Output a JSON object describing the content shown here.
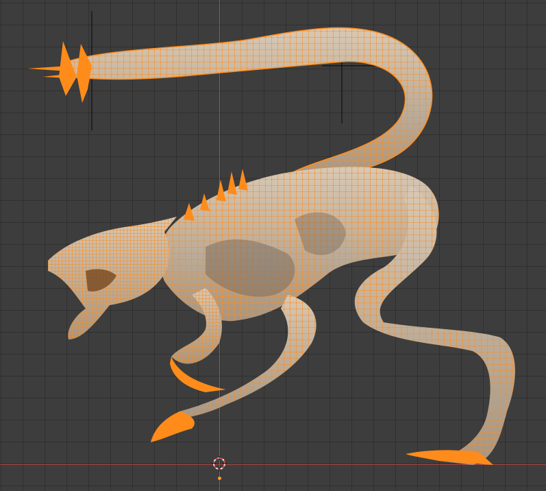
{
  "viewport": {
    "mode": "edit-mode-wireframe-overlay",
    "background_color": "#3d3d3d",
    "grid_color": "#333333",
    "x_axis_color": "#b84848",
    "z_axis_color": "#3f7dbf"
  },
  "mesh": {
    "name": "creature-mesh",
    "surface_color": "#c9b8a4",
    "shade_color": "#7e6f60",
    "wire_color": "#ff8c1a",
    "vertex_color": "#ff8c1a",
    "selection": "all-vertices-selected"
  },
  "cursor": {
    "icon": "3d-cursor-icon"
  },
  "origin": {
    "icon": "object-origin-icon"
  }
}
